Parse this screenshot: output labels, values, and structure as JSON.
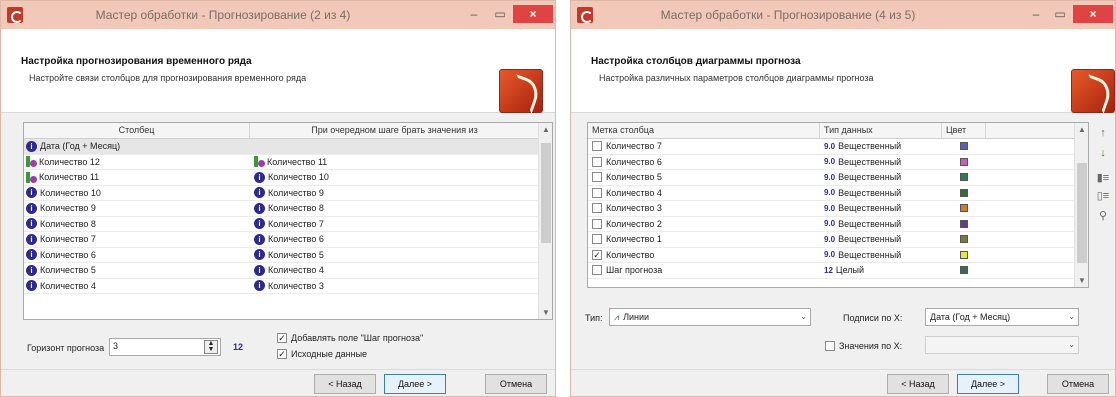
{
  "left_window": {
    "title": "Мастер обработки - Прогнозирование (2 из 4)",
    "controls": {
      "minimize": "–",
      "maximize": "▭",
      "close": "×"
    },
    "header": {
      "title": "Настройка прогнозирования временного ряда",
      "subtitle": "Настройте связи столбцов для прогнозирования временного ряда"
    },
    "grid": {
      "columns": [
        "Столбец",
        "При очередном шаге брать значения из"
      ],
      "rows": [
        {
          "icon": "info",
          "col1": "Дата (Год + Месяц)",
          "icon2": "",
          "col2": ""
        },
        {
          "icon": "lag",
          "col1": "Количество 12",
          "icon2": "lag",
          "col2": "Количество 11"
        },
        {
          "icon": "lag",
          "col1": "Количество 11",
          "icon2": "info",
          "col2": "Количество 10"
        },
        {
          "icon": "info",
          "col1": "Количество 10",
          "icon2": "info",
          "col2": "Количество 9"
        },
        {
          "icon": "info",
          "col1": "Количество 9",
          "icon2": "info",
          "col2": "Количество 8"
        },
        {
          "icon": "info",
          "col1": "Количество 8",
          "icon2": "info",
          "col2": "Количество 7"
        },
        {
          "icon": "info",
          "col1": "Количество 7",
          "icon2": "info",
          "col2": "Количество 6"
        },
        {
          "icon": "info",
          "col1": "Количество 6",
          "icon2": "info",
          "col2": "Количество 5"
        },
        {
          "icon": "info",
          "col1": "Количество 5",
          "icon2": "info",
          "col2": "Количество 4"
        },
        {
          "icon": "info",
          "col1": "Количество 4",
          "icon2": "info",
          "col2": "Количество 3"
        }
      ]
    },
    "horizon_label": "Горизонт прогноза",
    "horizon_value": "3",
    "horizon_badge": "12",
    "add_step_field_label": "Добавлять поле \"Шаг прогноза\"",
    "add_step_field_checked": true,
    "source_data_label": "Исходные данные",
    "source_data_checked": true,
    "buttons": {
      "back": "< Назад",
      "next": "Далее >",
      "cancel": "Отмена"
    }
  },
  "right_window": {
    "title": "Мастер обработки - Прогнозирование (4 из 5)",
    "controls": {
      "minimize": "–",
      "maximize": "▭",
      "close": "×"
    },
    "header": {
      "title": "Настройка столбцов диаграммы прогноза",
      "subtitle": "Настройка различных параметров столбцов диаграммы прогноза"
    },
    "grid": {
      "columns": [
        "Метка столбца",
        "Тип данных",
        "Цвет"
      ],
      "rows": [
        {
          "checked": false,
          "label": "Количество 7",
          "type_tag": "9.0",
          "type": "Вещественный",
          "color": "#5a5fbf"
        },
        {
          "checked": false,
          "label": "Количество 6",
          "type_tag": "9.0",
          "type": "Вещественный",
          "color": "#c85ac8"
        },
        {
          "checked": false,
          "label": "Количество 5",
          "type_tag": "9.0",
          "type": "Вещественный",
          "color": "#2a7a5a"
        },
        {
          "checked": false,
          "label": "Количество 4",
          "type_tag": "9.0",
          "type": "Вещественный",
          "color": "#3a6a3a"
        },
        {
          "checked": false,
          "label": "Количество 3",
          "type_tag": "9.0",
          "type": "Вещественный",
          "color": "#d07a2a"
        },
        {
          "checked": false,
          "label": "Количество 2",
          "type_tag": "9.0",
          "type": "Вещественный",
          "color": "#6a3a8a"
        },
        {
          "checked": false,
          "label": "Количество 1",
          "type_tag": "9.0",
          "type": "Вещественный",
          "color": "#7a7a3a"
        },
        {
          "checked": true,
          "label": "Количество",
          "type_tag": "9.0",
          "type": "Вещественный",
          "color": "#e8e83a"
        },
        {
          "checked": false,
          "label": "Шаг прогноза",
          "type_tag": "12",
          "type": "Целый",
          "color": "#3a6a5a"
        }
      ]
    },
    "side_tools": [
      "↑",
      "↓",
      "▮≡",
      "▯≡",
      "⚲"
    ],
    "type_label": "Тип:",
    "type_value": "Линии",
    "x_labels_label": "Подписи по X:",
    "x_labels_value": "Дата (Год + Месяц)",
    "x_values_label": "Значения по X:",
    "x_values_checked": false,
    "x_values_value": "",
    "buttons": {
      "back": "< Назад",
      "next": "Далее >",
      "cancel": "Отмена"
    }
  }
}
